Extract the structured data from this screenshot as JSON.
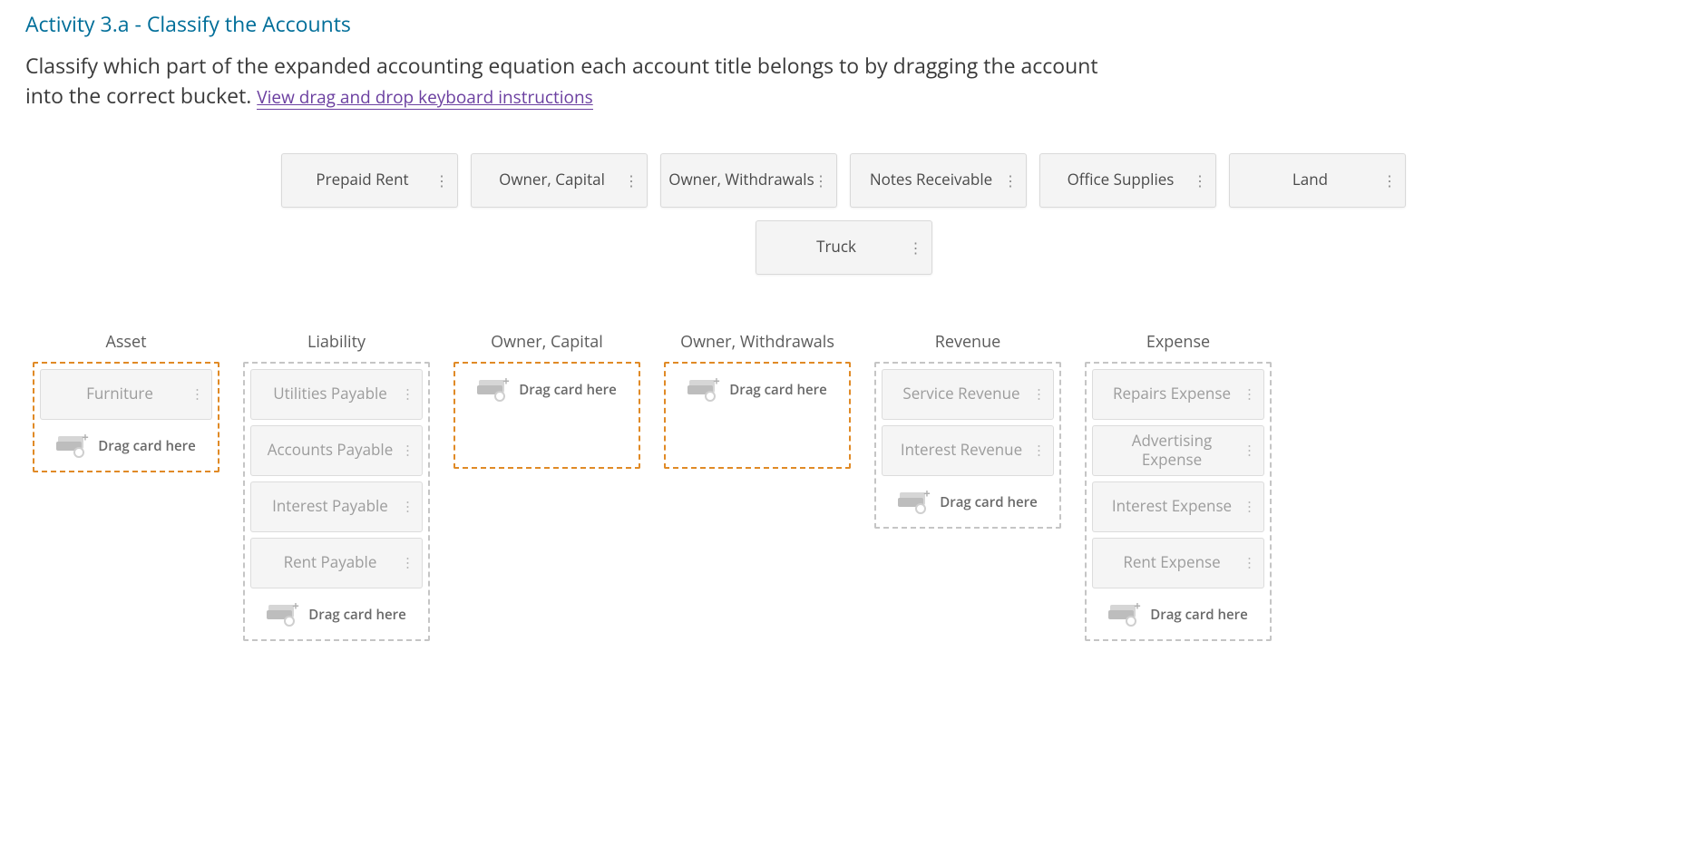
{
  "heading": "Activity 3.a - Classify the Accounts",
  "instructions_pre": "Classify which part of the expanded accounting equation each account title belongs to by dragging the account into the correct bucket. ",
  "instructions_link": "View drag and drop keyboard instructions",
  "drag_hint": "Drag card here",
  "source_cards_row1": [
    "Prepaid Rent",
    "Owner, Capital",
    "Owner, Withdrawals",
    "Notes Receivable",
    "Office Supplies",
    "Land"
  ],
  "source_cards_row2": [
    "Truck"
  ],
  "buckets": [
    {
      "title": "Asset",
      "highlight": true,
      "placed": [
        "Furniture"
      ]
    },
    {
      "title": "Liability",
      "highlight": false,
      "placed": [
        "Utilities Payable",
        "Accounts Payable",
        "Interest Payable",
        "Rent Payable"
      ]
    },
    {
      "title": "Owner, Capital",
      "highlight": true,
      "placed": []
    },
    {
      "title": "Owner, Withdrawals",
      "highlight": true,
      "placed": []
    },
    {
      "title": "Revenue",
      "highlight": false,
      "placed": [
        "Service Revenue",
        "Interest Revenue"
      ]
    },
    {
      "title": "Expense",
      "highlight": false,
      "placed": [
        "Repairs Expense",
        "Advertising Expense",
        "Interest Expense",
        "Rent Expense"
      ]
    }
  ]
}
